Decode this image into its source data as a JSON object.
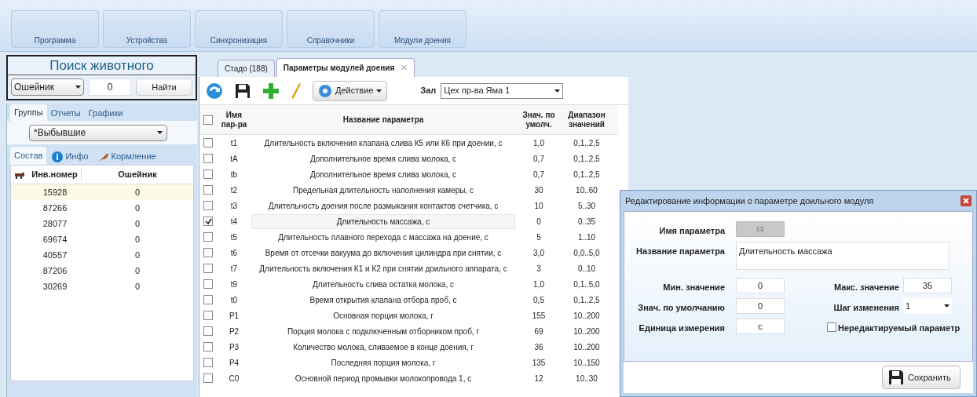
{
  "ribbon": {
    "buttons": [
      "Программа",
      "Устройства",
      "Синхронизация",
      "Справочники",
      "Модули доения"
    ]
  },
  "search": {
    "title": "Поиск животного",
    "field_type": "Ошейник",
    "value": "0",
    "button": "Найти"
  },
  "groups": {
    "tabs": [
      {
        "label": "Группы",
        "selected": true
      },
      {
        "label": "Отчеты",
        "selected": false
      },
      {
        "label": "Графики",
        "selected": false
      }
    ],
    "group_select": "*Выбывшие",
    "subtabs": [
      {
        "label": "Состав",
        "kind": "plain",
        "selected": true
      },
      {
        "label": "Инфо",
        "kind": "info",
        "selected": false
      },
      {
        "label": "Кормление",
        "kind": "feeding",
        "selected": false
      }
    ],
    "columns": [
      "Инв.номер",
      "Ошейник"
    ],
    "rows": [
      {
        "cells": [
          "15928",
          "0"
        ],
        "selected": true
      },
      {
        "cells": [
          "87266",
          "0"
        ],
        "selected": false
      },
      {
        "cells": [
          "28077",
          "0"
        ],
        "selected": false
      },
      {
        "cells": [
          "69674",
          "0"
        ],
        "selected": false
      },
      {
        "cells": [
          "40557",
          "0"
        ],
        "selected": false
      },
      {
        "cells": [
          "87206",
          "0"
        ],
        "selected": false
      },
      {
        "cells": [
          "30269",
          "0"
        ],
        "selected": false
      }
    ]
  },
  "doc_tabs": [
    {
      "label": "Стадо (188)",
      "selected": false,
      "closable": false
    },
    {
      "label": "Параметры модулей доения",
      "selected": true,
      "closable": true
    }
  ],
  "close_glyph": "×",
  "toolbar": {
    "action": "Действие",
    "hall_label": "Зал",
    "hall_value": "Цех пр-ва Яма 1"
  },
  "table": {
    "all_checked": false,
    "columns": [
      "Имя пар-ра",
      "Название параметра",
      "Знач. по умолч.",
      "Диапазон значений"
    ],
    "rows": [
      {
        "checked": false,
        "cells": [
          "t1",
          "Длительность включения клапана слива К5 или К6 при доении, с",
          "1,0",
          "0,1..2,5"
        ]
      },
      {
        "checked": false,
        "cells": [
          "tA",
          "Дополнительное время слива молока, с",
          "0,7",
          "0,1..2,5"
        ]
      },
      {
        "checked": false,
        "cells": [
          "tb",
          "Дополнительное время слива молока, с",
          "0,7",
          "0,1..2,5"
        ]
      },
      {
        "checked": false,
        "cells": [
          "t2",
          "Предельная длительность наполнения камеры, с",
          "30",
          "10..60"
        ]
      },
      {
        "checked": false,
        "cells": [
          "t3",
          "Длительность доения после размыкания контактов счетчика, с",
          "10",
          "5..30"
        ]
      },
      {
        "checked": true,
        "cells": [
          "t4",
          "Длительность массажа, с",
          "0",
          "0..35"
        ]
      },
      {
        "checked": false,
        "cells": [
          "t5",
          "Длительность плавного перехода с массажа на доение, с",
          "5",
          "1..10"
        ]
      },
      {
        "checked": false,
        "cells": [
          "t6",
          "Время от отсечки вакуума до включения цилиндра при снятии, с",
          "3,0",
          "0,0..5,0"
        ]
      },
      {
        "checked": false,
        "cells": [
          "t7",
          "Длительность включения К1 и К2 при снятии доильного аппарата, с",
          "3",
          "0..10"
        ]
      },
      {
        "checked": false,
        "cells": [
          "t9",
          "Длительность слива остатка молока, с",
          "1,0",
          "0,1..5,0"
        ]
      },
      {
        "checked": false,
        "cells": [
          "t0",
          "Время открытия клапана отбора проб, с",
          "0,5",
          "0,1..2,5"
        ]
      },
      {
        "checked": false,
        "cells": [
          "P1",
          "Основная порция молока, г",
          "155",
          "10..200"
        ]
      },
      {
        "checked": false,
        "cells": [
          "P2",
          "Порция молока с подключенным отборником проб, г",
          "69",
          "10..200"
        ]
      },
      {
        "checked": false,
        "cells": [
          "P3",
          "Количество молока, сливаемое в конце доения, г",
          "36",
          "10..200"
        ]
      },
      {
        "checked": false,
        "cells": [
          "P4",
          "Последняя порция молока, г",
          "135",
          "10..150"
        ]
      },
      {
        "checked": false,
        "cells": [
          "C0",
          "Основной период промывки молокопровода 1, с",
          "12",
          "10..30"
        ]
      }
    ]
  },
  "dialog": {
    "title": "Редактирование информации о параметре доильного модуля",
    "name_label": "Имя параметра",
    "name_value": "t4",
    "title_label": "Название параметра",
    "title_value": "Длительность массажа",
    "min_label": "Мин. значение",
    "min_value": "0",
    "max_label": "Макс. значение",
    "max_value": "35",
    "default_label": "Знач. по умолчанию",
    "default_value": "0",
    "step_label": "Шаг изменения",
    "step_value": "1",
    "unit_label": "Единица измерения",
    "unit_value": "с",
    "readonly_label": "Нередактируемый параметр",
    "readonly": false,
    "save": "Сохранить"
  }
}
